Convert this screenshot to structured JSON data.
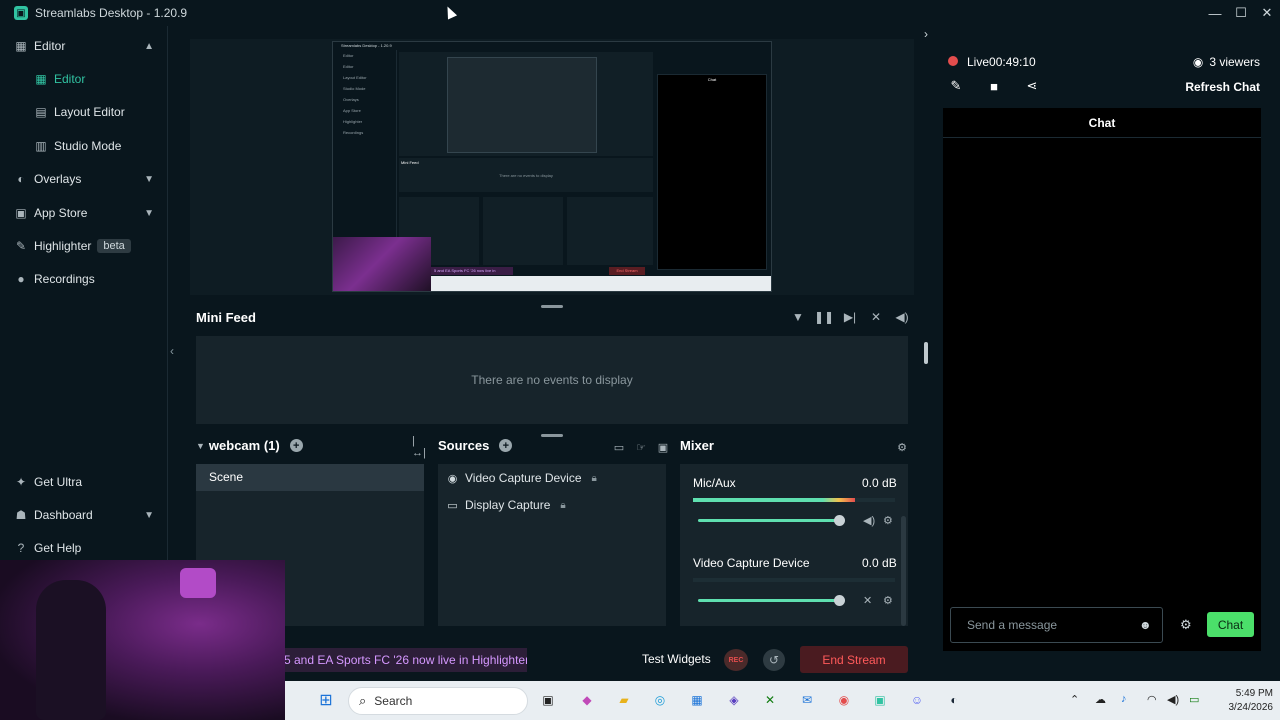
{
  "window": {
    "title": "Streamlabs Desktop - 1.20.9",
    "logo": "streamlabs-logo"
  },
  "sidebar": {
    "items": [
      {
        "label": "Editor",
        "icon": "editor-icon"
      },
      {
        "label": "Editor",
        "icon": "editor-grid-icon"
      },
      {
        "label": "Layout Editor",
        "icon": "layout-icon"
      },
      {
        "label": "Studio Mode",
        "icon": "studio-icon"
      },
      {
        "label": "Overlays",
        "icon": "overlays-icon"
      },
      {
        "label": "App Store",
        "icon": "store-icon"
      },
      {
        "label": "Highlighter",
        "icon": "highlighter-icon",
        "badge": "beta"
      },
      {
        "label": "Recordings",
        "icon": "recordings-icon"
      }
    ],
    "bottom": [
      {
        "label": "Get Ultra"
      },
      {
        "label": "Dashboard"
      },
      {
        "label": "Get Help"
      }
    ]
  },
  "mini_feed": {
    "title": "Mini Feed",
    "empty_text": "There are no events to display"
  },
  "scenes": {
    "title": "webcam (1)",
    "items": [
      "Scene"
    ]
  },
  "sources": {
    "title": "Sources",
    "items": [
      {
        "label": "Video Capture Device",
        "icon": "webcam-icon"
      },
      {
        "label": "Display Capture",
        "icon": "monitor-icon"
      }
    ]
  },
  "mixer": {
    "title": "Mixer",
    "channels": [
      {
        "name": "Mic/Aux",
        "db": "0.0 dB",
        "level": 0.8,
        "volume": 0.98
      },
      {
        "name": "Video Capture Device",
        "db": "0.0 dB",
        "level": 0.0,
        "volume": 0.98
      }
    ]
  },
  "footer": {
    "banner": "5 and EA Sports FC '26 now live in Highlighter!",
    "test_widgets": "Test Widgets",
    "rec": "REC",
    "end_stream": "End Stream"
  },
  "chat": {
    "live_label": "Live",
    "live_time": "00:49:10",
    "viewers": "3 viewers",
    "refresh": "Refresh Chat",
    "header": "Chat",
    "placeholder": "Send a message",
    "send_button": "Chat"
  },
  "nested_preview": {
    "title": "Streamlabs Desktop - 1.20.9",
    "lines": [
      "Editor",
      "Editor",
      "Layout Editor",
      "Studio Mode",
      "Overlays",
      "App Store",
      "Highlighter",
      "Recordings"
    ],
    "mini_feed": "Mini Feed",
    "empty": "There are no events to display",
    "chat": "Chat",
    "banner": "5 and EA Sports FC '26 now live in Highlighter!",
    "end": "End Stream"
  },
  "taskbar": {
    "search_placeholder": "Search",
    "time": "5:49 PM",
    "date": "3/24/2026"
  }
}
